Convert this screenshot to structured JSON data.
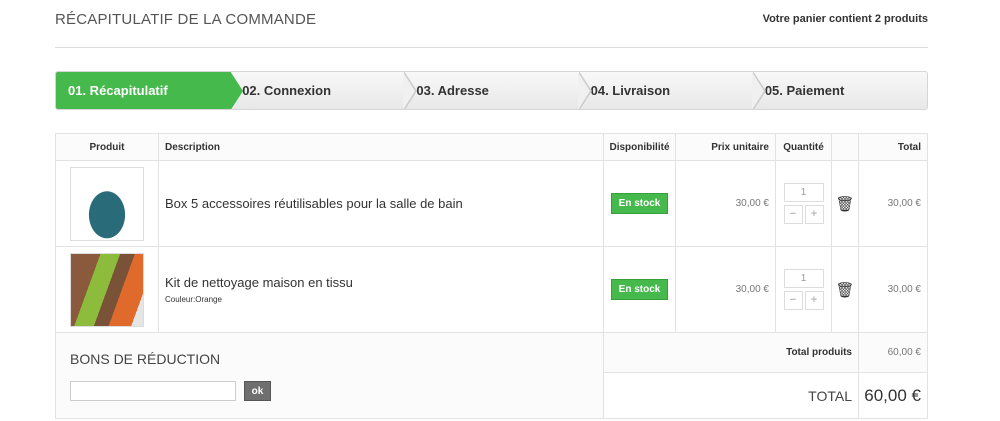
{
  "header": {
    "title": "RÉCAPITULATIF DE LA COMMANDE",
    "cart_count": "Votre panier contient 2 produits"
  },
  "steps": [
    "01. Récapitulatif",
    "02. Connexion",
    "03. Adresse",
    "04. Livraison",
    "05. Paiement"
  ],
  "columns": {
    "product": "Produit",
    "description": "Description",
    "availability": "Disponibilité",
    "unit_price": "Prix unitaire",
    "quantity": "Quantité",
    "total": "Total"
  },
  "items": [
    {
      "name": "Box 5 accessoires réutilisables pour la salle de bain",
      "attr": "",
      "availability": "En stock",
      "unit_price": "30,00 €",
      "quantity": "1",
      "total": "30,00 €"
    },
    {
      "name": "Kit de nettoyage maison en tissu",
      "attr": "Couleur:Orange",
      "availability": "En stock",
      "unit_price": "30,00 €",
      "quantity": "1",
      "total": "30,00 €"
    }
  ],
  "voucher": {
    "title": "BONS DE RÉDUCTION",
    "button": "ok",
    "value": ""
  },
  "totals": {
    "products_label": "Total produits",
    "products_value": "60,00 €",
    "total_label": "TOTAL",
    "total_value": "60,00 €"
  },
  "colors": {
    "accent": "#46b94d"
  }
}
